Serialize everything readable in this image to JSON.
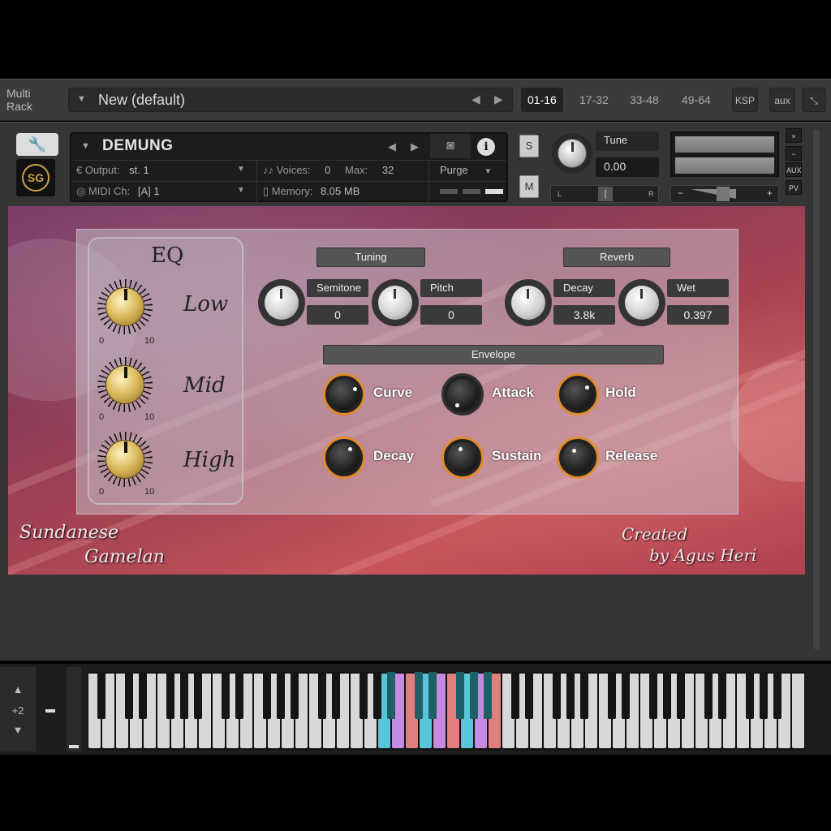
{
  "rack": {
    "label_line1": "Multi",
    "label_line2": "Rack",
    "name": "New (default)",
    "pages": [
      "01-16",
      "17-32",
      "33-48",
      "49-64"
    ],
    "active_page": "01-16",
    "ksp": "KSP",
    "aux": "aux"
  },
  "instrument": {
    "name": "DEMUNG",
    "logo_text": "SG",
    "output_label": "Output:",
    "output_value": "st. 1",
    "voices_label": "Voices:",
    "voices_value": "0",
    "max_label": "Max:",
    "max_value": "32",
    "purge_label": "Purge",
    "midi_label": "MIDI Ch:",
    "midi_value": "[A]  1",
    "memory_label": "Memory:",
    "memory_value": "8.05 MB",
    "solo_label": "S",
    "mute_label": "M",
    "tune_label": "Tune",
    "tune_value": "0.00",
    "pan_left": "L",
    "pan_right": "R",
    "vol_minus": "−",
    "vol_plus": "+",
    "side_close": "×",
    "side_min": "−",
    "side_aux": "AUX",
    "side_pv": "PV"
  },
  "gui": {
    "eq": {
      "title": "EQ",
      "range_min": "0",
      "range_max": "10",
      "bands": [
        "Low",
        "Mid",
        "High"
      ]
    },
    "tuning": {
      "title": "Tuning",
      "semitone_label": "Semitone",
      "semitone_value": "0",
      "pitch_label": "Pitch",
      "pitch_value": "0"
    },
    "reverb": {
      "title": "Reverb",
      "decay_label": "Decay",
      "decay_value": "3.8k",
      "wet_label": "Wet",
      "wet_value": "0.397"
    },
    "envelope": {
      "title": "Envelope",
      "knobs": [
        "Curve",
        "Attack",
        "Hold",
        "Decay",
        "Sustain",
        "Release"
      ]
    },
    "footer_left_1": "Sundanese",
    "footer_left_2": "Gamelan",
    "footer_right_1": "Created",
    "footer_right_2": "by Agus Heri"
  },
  "keyboard": {
    "octave_shift": "+2",
    "highlight_colors": [
      "#58c6d8",
      "#c58be0",
      "#e0807e"
    ]
  }
}
